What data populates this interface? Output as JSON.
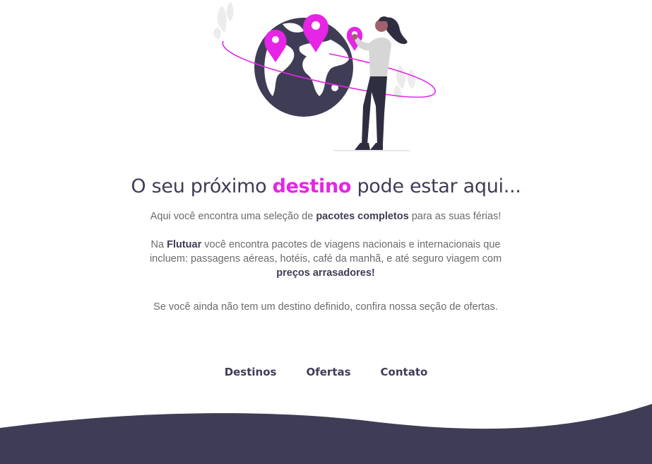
{
  "hero": {
    "title_before": "O seu próximo ",
    "title_accent": "destino",
    "title_after": " pode estar aqui..."
  },
  "intro": {
    "p1_before": "Aqui você encontra uma seleção de ",
    "p1_bold": "pacotes completos",
    "p1_after": " para as suas férias!",
    "p2_before": "Na ",
    "p2_brand": "Flutuar",
    "p2_middle": " você encontra pacotes de viagens nacionais e internacionais que incluem: passagens aéreas, hotéis, café da manhã, e até seguro viagem com ",
    "p2_bold": "preços arrasadores!",
    "p3": "Se você ainda não tem um destino definido, confira nossa seção de ofertas."
  },
  "nav": {
    "destinos": "Destinos",
    "ofertas": "Ofertas",
    "contato": "Contato"
  },
  "colors": {
    "accent": "#e625e6",
    "dark": "#3f3d56",
    "text": "#6b6b6b"
  },
  "icons": [
    "globe-illustration",
    "map-pin-icon",
    "woman-illustration",
    "leaf-icon"
  ]
}
